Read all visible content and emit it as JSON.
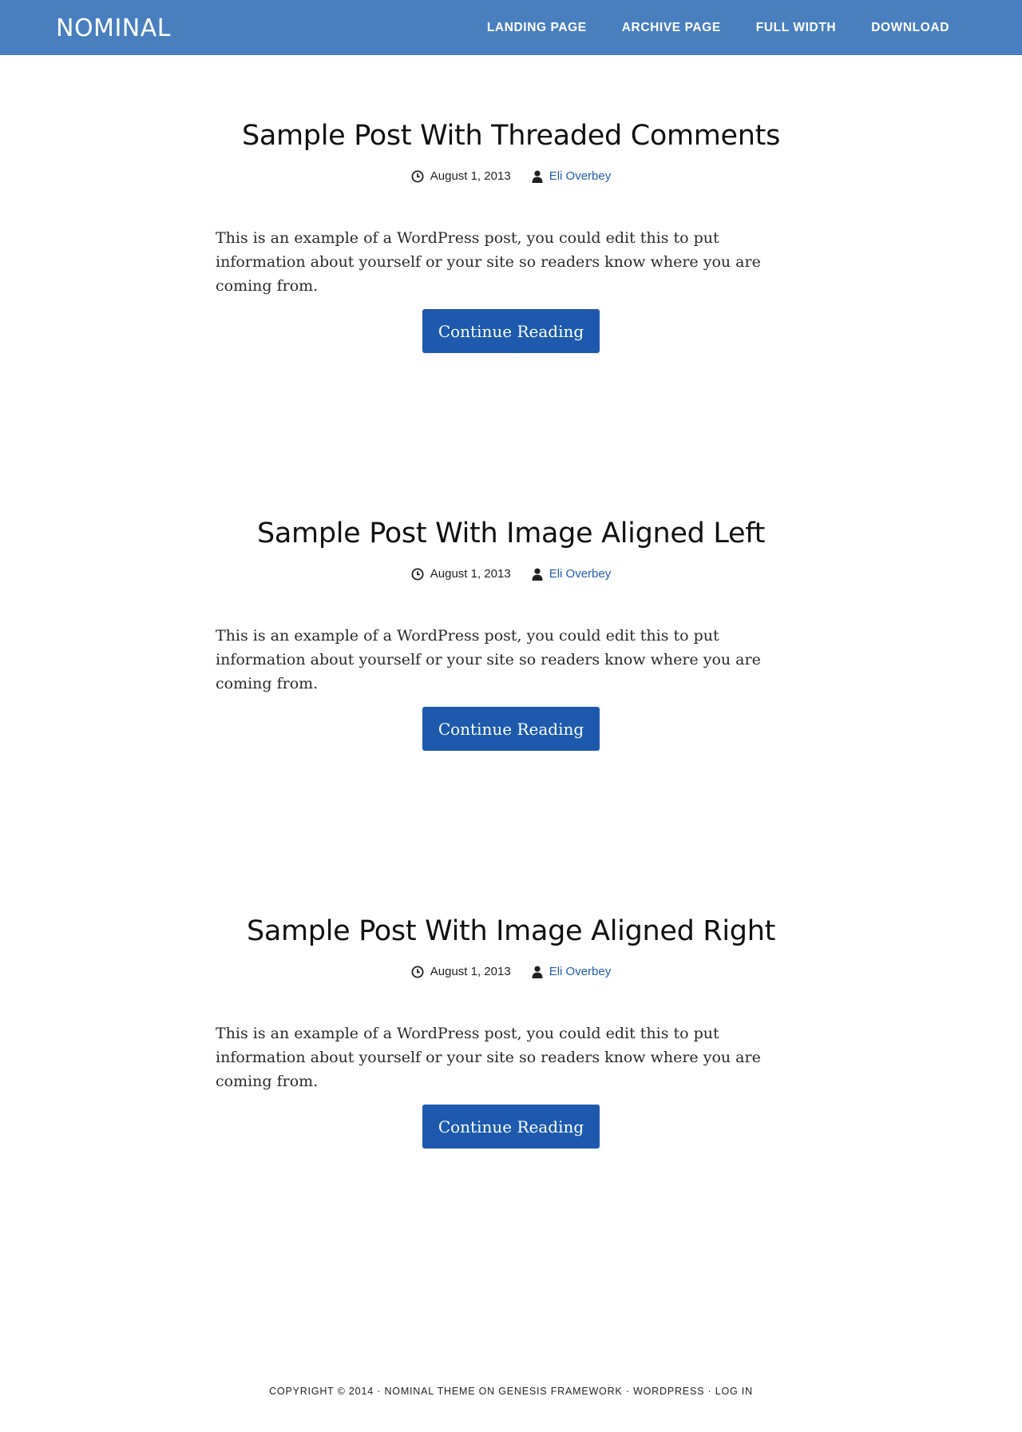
{
  "site": {
    "title": "NOMINAL"
  },
  "nav": {
    "items": [
      "LANDING PAGE",
      "ARCHIVE PAGE",
      "FULL WIDTH",
      "DOWNLOAD"
    ]
  },
  "posts": [
    {
      "title": "Sample Post With Threaded Comments",
      "date": "August 1, 2013",
      "author": "Eli Overbey",
      "excerpt": "This is an example of a WordPress post, you could edit this to put information about yourself or your site so readers know where you are coming from.",
      "button": "Continue Reading"
    },
    {
      "title": "Sample Post With Image Aligned Left",
      "date": "August 1, 2013",
      "author": "Eli Overbey",
      "excerpt": "This is an example of a WordPress post, you could edit this to put information about yourself or your site so readers know where you are coming from.",
      "button": "Continue Reading"
    },
    {
      "title": "Sample Post With Image Aligned Right",
      "date": "August 1, 2013",
      "author": "Eli Overbey",
      "excerpt": "This is an example of a WordPress post, you could edit this to put information about yourself or your site so readers know where you are coming from.",
      "button": "Continue Reading"
    }
  ],
  "footer": {
    "copyright": "COPYRIGHT © 2014",
    "sep": " · ",
    "theme_link": "NOMINAL THEME",
    "on_text": " ON ",
    "framework_link": "GENESIS FRAMEWORK",
    "wordpress_link": "WORDPRESS",
    "login_link": "LOG IN"
  },
  "icons": {
    "date": "clock-icon",
    "author": "user-icon"
  },
  "colors": {
    "header_bg": "#497fbf",
    "button_bg": "#1d5aae",
    "link": "#1f5dae"
  }
}
